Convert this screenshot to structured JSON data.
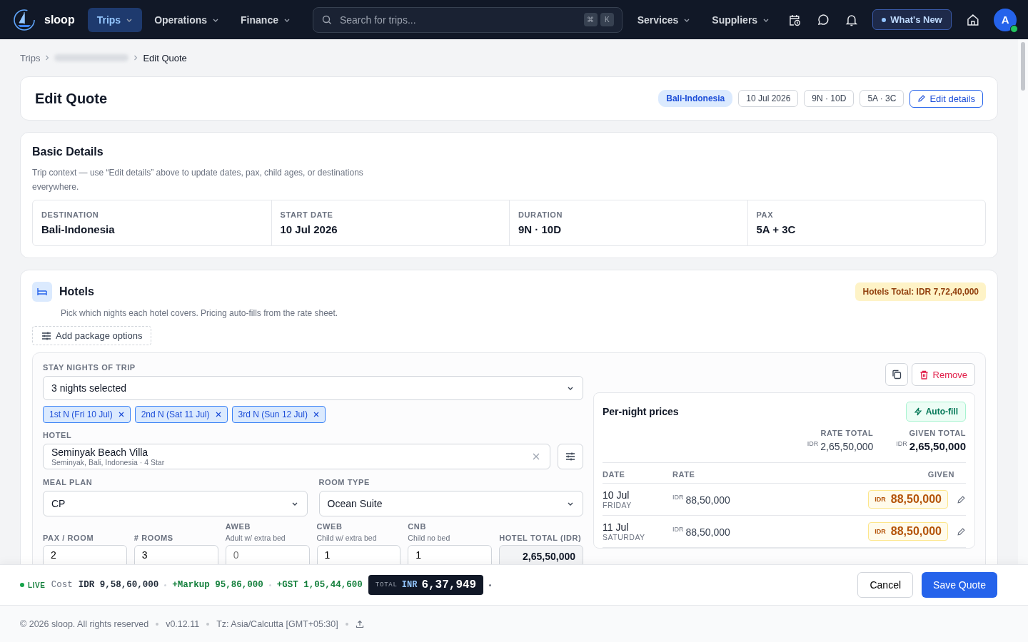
{
  "brand": {
    "name": "sloop"
  },
  "nav": {
    "left": [
      {
        "label": "Trips",
        "selected": true
      },
      {
        "label": "Operations",
        "selected": false
      },
      {
        "label": "Finance",
        "selected": false
      }
    ],
    "search": {
      "placeholder": "Search for trips...",
      "keys": [
        "⌘",
        "K"
      ]
    },
    "right": [
      {
        "label": "Services",
        "selected": false
      },
      {
        "label": "Suppliers",
        "selected": false
      }
    ],
    "whats_new": "What's New",
    "avatar": "A",
    "online": true
  },
  "breadcrumb": {
    "first": "Trips",
    "current": "Edit Quote"
  },
  "header": {
    "title": "Edit Quote",
    "tags": [
      {
        "label": "Bali-Indonesia",
        "kind": "accent"
      },
      {
        "label": "10 Jul 2026",
        "kind": "plain"
      },
      {
        "label": "9N · 10D",
        "kind": "plain"
      },
      {
        "label": "5A · 3C",
        "kind": "plain"
      }
    ],
    "edit_button": "Edit details"
  },
  "basic_details": {
    "title": "Basic Details",
    "description": "Trip context — use “Edit details” above to update dates, pax, child ages, or destinations everywhere.",
    "fields": [
      {
        "label": "DESTINATION",
        "value": "Bali-Indonesia"
      },
      {
        "label": "START DATE",
        "value": "10 Jul 2026"
      },
      {
        "label": "DURATION",
        "value": "9N · 10D"
      },
      {
        "label": "PAX",
        "value": "5A + 3C"
      }
    ]
  },
  "hotels": {
    "title": "Hotels",
    "total": "Hotels Total: IDR 7,72,40,000",
    "description": "Pick which nights each hotel covers. Pricing auto-fills from the rate sheet.",
    "add_options": "Add package options",
    "stay_nights": {
      "label": "STAY NIGHTS OF TRIP",
      "value": "3 nights selected",
      "chips": [
        "1st N (Fri 10 Jul)",
        "2nd N (Sat 11 Jul)",
        "3rd N (Sun 12 Jul)"
      ]
    },
    "hotel": {
      "label": "HOTEL",
      "name": "Seminyak Beach Villa",
      "detail": "Seminyak, Bali, Indonesia · 4 Star"
    },
    "meal_plan": {
      "label": "MEAL PLAN",
      "value": "CP"
    },
    "room_type": {
      "label": "ROOM TYPE",
      "value": "Ocean Suite"
    },
    "counts": [
      {
        "label": "PAX / ROOM",
        "value": "2"
      },
      {
        "label": "# ROOMS",
        "value": "3"
      },
      {
        "label": "AWEB",
        "hint": "Adult w/ extra bed",
        "placeholder": "0"
      },
      {
        "label": "CWEB",
        "hint": "Child w/ extra bed",
        "value": "1"
      },
      {
        "label": "CNB",
        "hint": "Child no bed",
        "value": "1"
      },
      {
        "label": "HOTEL TOTAL (IDR)",
        "value": "2,65,50,000",
        "kind": "readonly"
      }
    ],
    "remove": "Remove",
    "per_night": {
      "title": "Per-night prices",
      "autofill": "Auto-fill",
      "rate_total_label": "RATE TOTAL",
      "rate_total_currency": "IDR",
      "rate_total": "2,65,50,000",
      "given_total_label": "GIVEN TOTAL",
      "given_total_currency": "IDR",
      "given_total": "2,65,50,000",
      "columns": [
        "DATE",
        "RATE",
        "GIVEN"
      ],
      "rows": [
        {
          "date": "10 Jul",
          "weekday": "FRIDAY",
          "rate_currency": "IDR",
          "rate": "88,50,000",
          "given_currency": "IDR",
          "given": "88,50,000"
        },
        {
          "date": "11 Jul",
          "weekday": "SATURDAY",
          "rate_currency": "IDR",
          "rate": "88,50,000",
          "given_currency": "IDR",
          "given": "88,50,000"
        }
      ]
    }
  },
  "summary": {
    "live": "LIVE",
    "cost_label": "Cost",
    "cost": "IDR 9,58,60,000",
    "markup": "+Markup 95,86,000",
    "gst": "+GST 1,05,44,600",
    "total_label": "TOTAL",
    "total_currency": "INR",
    "total": "6,37,949",
    "cancel": "Cancel",
    "save": "Save Quote"
  },
  "footer": {
    "copyright": "© 2026 sloop. All rights reserved",
    "version": "v0.12.11",
    "timezone": "Tz: Asia/Calcutta [GMT+05:30]"
  }
}
